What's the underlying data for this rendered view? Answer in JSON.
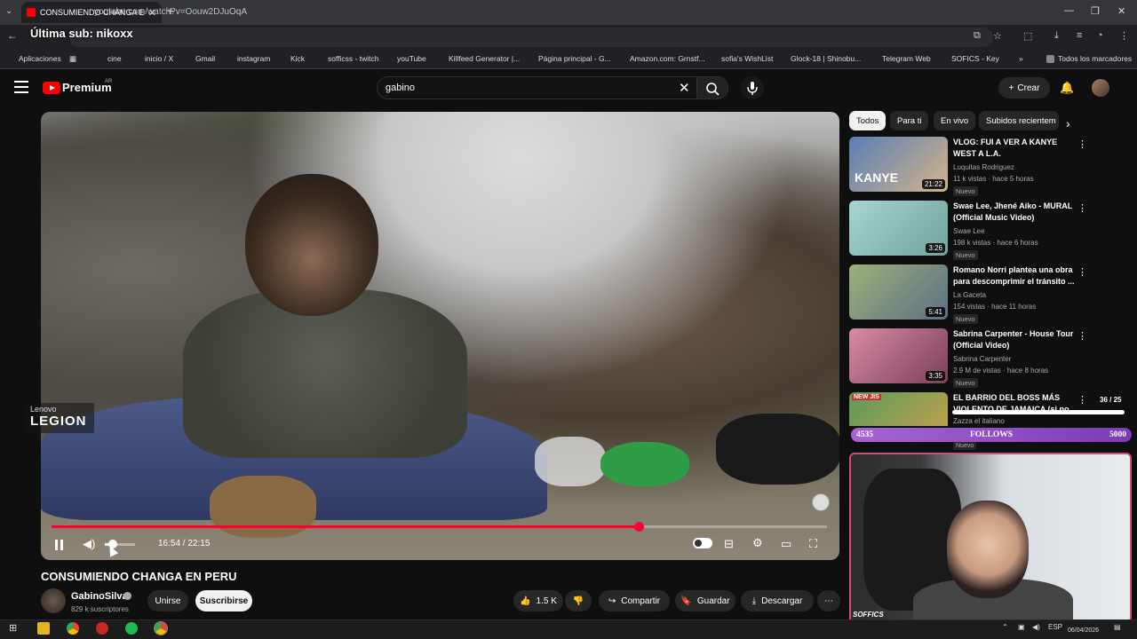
{
  "browser": {
    "tab_title": "CONSUMIENDO CHANGA E",
    "new_tab": "+",
    "url": "youtube.com/watch?v=Oouw2DJuOqA",
    "overlay_text": "Última sub: nikoxx",
    "bookmarks": [
      {
        "label": "Aplicaciones",
        "color": "#666"
      },
      {
        "label": "cine",
        "color": "#888"
      },
      {
        "label": "inicio / X",
        "color": "#fff"
      },
      {
        "label": "Gmail",
        "color": "#ea4335"
      },
      {
        "label": "instagram",
        "color": "#d6249f"
      },
      {
        "label": "Kick",
        "color": "#53fc18"
      },
      {
        "label": "sofficss - twitch",
        "color": "#9146ff"
      },
      {
        "label": "youTube",
        "color": "#ff0000"
      },
      {
        "label": "Killfeed Generator |...",
        "color": "#f5c518"
      },
      {
        "label": "Página principal - G...",
        "color": "#4caf50"
      },
      {
        "label": "Amazon.com: Grnstf...",
        "color": "#ff9900"
      },
      {
        "label": "sofia's WishList",
        "color": "#4a7bd8"
      },
      {
        "label": "Glock-18 | Shinobu...",
        "color": "#fff"
      },
      {
        "label": "Telegram Web",
        "color": "#2aabee"
      },
      {
        "label": "SOFICS - Key",
        "color": "#e53935"
      }
    ],
    "more_bookmarks": "»",
    "all_bookmarks": "Todos los marcadores"
  },
  "youtube": {
    "logo_text": "Premium",
    "country": "AR",
    "search_value": "gabino",
    "create_label": "Crear",
    "colors": {
      "brand": "#ff0000",
      "progress": "#ff0033"
    }
  },
  "player": {
    "brand_top": "Lenovo",
    "brand_bottom": "LEGION",
    "time": "16:54 / 22:15",
    "progress": 0.757,
    "volume": 0.2
  },
  "video": {
    "title": "CONSUMIENDO CHANGA EN PERU",
    "channel": "GabinoSilva",
    "subscribers": "829 k suscriptores",
    "join_label": "Unirse",
    "subscribe_label": "Suscribirse",
    "likes": "1.5 K",
    "share_label": "Compartir",
    "save_label": "Guardar",
    "download_label": "Descargar"
  },
  "chips": [
    "Todos",
    "Para ti",
    "En vivo",
    "Subidos recientem"
  ],
  "recommendations": [
    {
      "title": "VLOG: FUI A VER A KANYE WEST A L.A.",
      "channel": "Luquitas Rodriguez",
      "meta": "11 k vistas · hace 5 horas",
      "badge": "Nuevo",
      "duration": "21:22",
      "thumb_text": "KANYE",
      "thumb_color": "#6a8fc4",
      "verified": false
    },
    {
      "title": "Swae Lee, Jhené Aiko - MURAL (Official Music Video)",
      "channel": "Swae Lee",
      "meta": "198 k vistas · hace 6 horas",
      "badge": "Nuevo",
      "duration": "3:26",
      "thumb_text": "",
      "thumb_color": "#7fb9b1",
      "verified": true
    },
    {
      "title": "Romano Norri plantea una obra para descomprimir el tránsito ...",
      "channel": "La Gaceta",
      "meta": "154 vistas · hace 11 horas",
      "badge": "Nuevo",
      "duration": "5:41",
      "thumb_text": "",
      "thumb_color": "#8a9b6a",
      "verified": false
    },
    {
      "title": "Sabrina Carpenter - House Tour (Official Video)",
      "channel": "Sabrina Carpenter",
      "meta": "2.9 M de vistas · hace 8 horas",
      "badge": "Nuevo",
      "duration": "3:35",
      "thumb_text": "",
      "thumb_color": "#c07090",
      "verified": true
    },
    {
      "title": "EL BARRIO DEL BOSS MÁS VIOLENTO DE JAMAICA (si no",
      "channel": "Zazza el italiano",
      "meta": "",
      "badge": "Nuevo",
      "duration": "",
      "thumb_text": "NEW JIS",
      "thumb_color": "#4a8a4a",
      "verified": true
    }
  ],
  "stream": {
    "goal_counter": "36 / 25",
    "follows_current": "4535",
    "follows_label": "FOLLOWS",
    "follows_goal": "5000",
    "cam_label": "SOFFICS"
  },
  "taskbar": {
    "lang": "ESP",
    "date": "06/04/2026"
  }
}
